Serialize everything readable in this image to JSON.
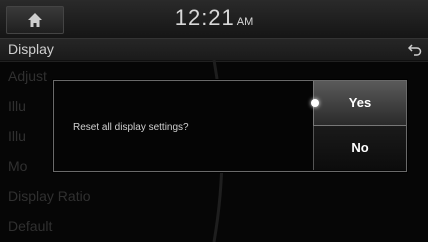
{
  "status": {
    "time": "12:21",
    "ampm": "AM"
  },
  "header": {
    "title": "Display"
  },
  "menu": {
    "items": [
      "Adjust",
      "Illu",
      "Illu",
      "Mo",
      "Display Ratio",
      "Default"
    ]
  },
  "dialog": {
    "message": "Reset all display settings?",
    "yes_label": "Yes",
    "no_label": "No"
  }
}
